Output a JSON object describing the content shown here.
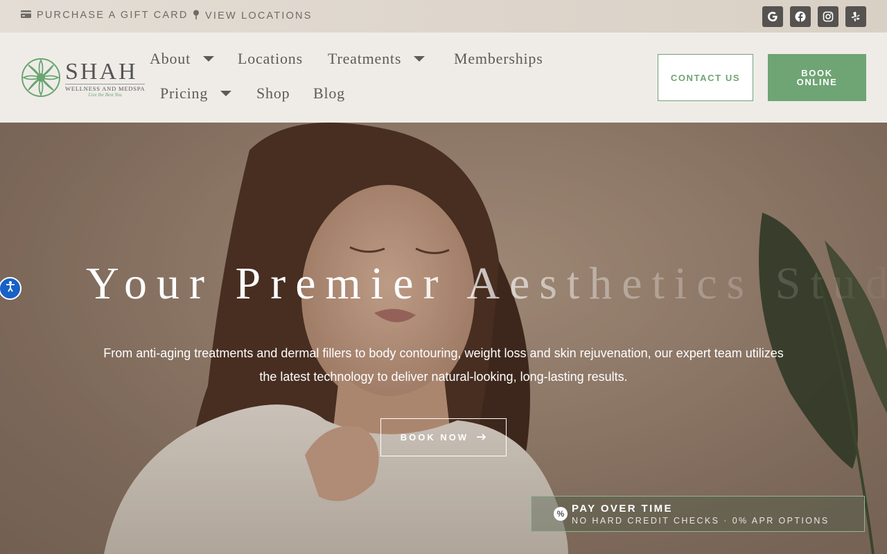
{
  "topbar": {
    "gift_label": "PURCHASE A GIFT CARD",
    "locations_label": "VIEW LOCATIONS",
    "social": [
      {
        "icon": "google-icon"
      },
      {
        "icon": "facebook-icon"
      },
      {
        "icon": "instagram-icon"
      },
      {
        "icon": "yelp-icon"
      }
    ]
  },
  "header": {
    "logo": {
      "name": "SHAH",
      "subtitle": "WELLNESS AND MEDSPA",
      "tagline": "Live the Best You"
    },
    "nav": {
      "about": "About",
      "locations": "Locations",
      "treatments": "Treatments",
      "memberships": "Memberships",
      "pricing": "Pricing",
      "shop": "Shop",
      "blog": "Blog"
    },
    "contact_label": "CONTACT US",
    "book_online_label": "BOOK ONLINE"
  },
  "hero": {
    "title": "Your Premier Aesthetics Studio",
    "description": "From anti-aging treatments and dermal fillers to body contouring, weight loss and skin rejuvenation, our expert team utilizes the latest technology to deliver natural-looking, long-lasting results.",
    "book_now_label": "BOOK NOW",
    "pay": {
      "title": "PAY OVER TIME",
      "subtitle": "NO HARD CREDIT CHECKS · 0% APR OPTIONS"
    }
  },
  "colors": {
    "brand_green": "#6fa474",
    "text_gray": "#5e5a55",
    "accessibility_blue": "#1761c7"
  }
}
